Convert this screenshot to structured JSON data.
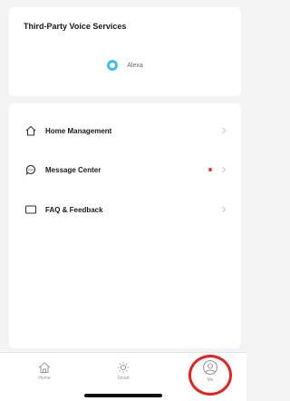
{
  "voice_services": {
    "title": "Third-Party Voice Services",
    "alexa_label": "Alexa"
  },
  "menu": {
    "items": [
      {
        "label": "Home Management",
        "icon": "house-icon",
        "has_badge": false
      },
      {
        "label": "Message Center",
        "icon": "message-icon",
        "has_badge": true
      },
      {
        "label": "FAQ & Feedback",
        "icon": "feedback-icon",
        "has_badge": false
      }
    ]
  },
  "tabbar": {
    "tabs": [
      {
        "label": "Home",
        "icon": "home-tab-icon",
        "active": false
      },
      {
        "label": "Smart",
        "icon": "sun-icon",
        "active": false
      },
      {
        "label": "Me",
        "icon": "profile-icon",
        "active": true
      }
    ]
  },
  "colors": {
    "accent_alexa": "#3cc0e8",
    "badge_red": "#e53935",
    "highlight": "#e32222"
  }
}
